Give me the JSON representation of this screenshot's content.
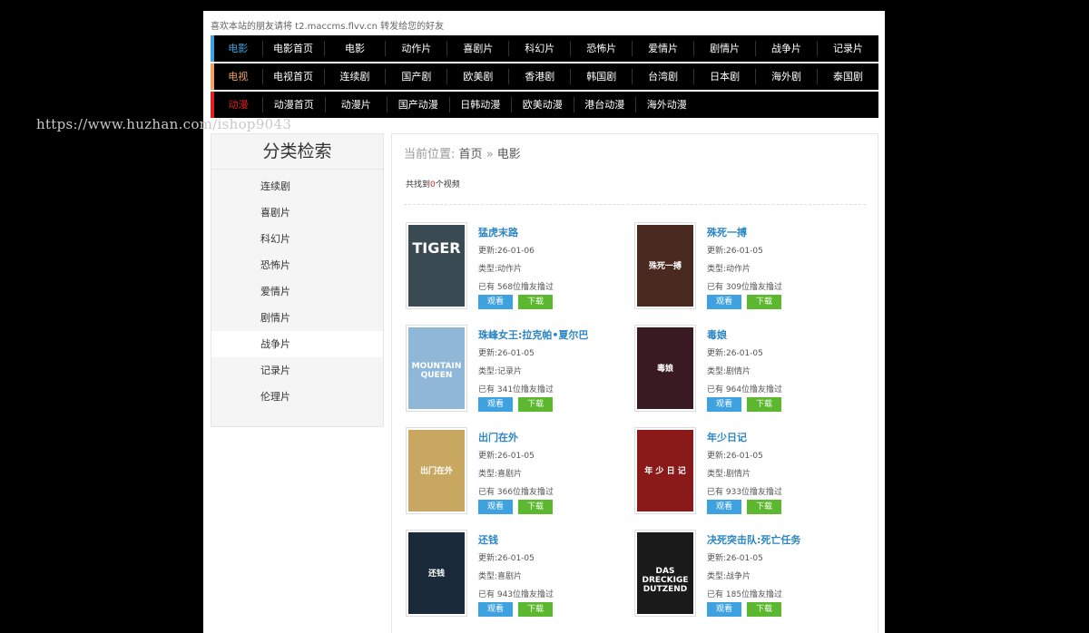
{
  "notice": "喜欢本站的朋友请将 t2.maccms.flvv.cn 转发给您的好友",
  "nav": [
    {
      "category": "电影",
      "items": [
        "电影首页",
        "电影",
        "动作片",
        "喜剧片",
        "科幻片",
        "恐怖片",
        "爱情片",
        "剧情片",
        "战争片",
        "记录片"
      ]
    },
    {
      "category": "电视",
      "items": [
        "电视首页",
        "连续剧",
        "国产剧",
        "欧美剧",
        "香港剧",
        "韩国剧",
        "台湾剧",
        "日本剧",
        "海外剧",
        "泰国剧"
      ]
    },
    {
      "category": "动漫",
      "items": [
        "动漫首页",
        "动漫片",
        "国产动漫",
        "日韩动漫",
        "欧美动漫",
        "港台动漫",
        "海外动漫"
      ]
    }
  ],
  "watermark": "https://www.huzhan.com/ishop9043",
  "sidebar": {
    "title": "分类检索",
    "items": [
      "连续剧",
      "喜剧片",
      "科幻片",
      "恐怖片",
      "爱情片",
      "剧情片",
      "战争片",
      "记录片",
      "伦理片"
    ]
  },
  "breadcrumb": {
    "prefix": "当前位置:",
    "home": "首页",
    "sep": "»",
    "current": "电影"
  },
  "result": {
    "before": "共找到",
    "num": "0",
    "after": "个视频"
  },
  "buttons": {
    "watch": "观看",
    "download": "下载"
  },
  "movies": [
    {
      "title": "猛虎末路",
      "updated": "更新:26-01-06",
      "genre": "类型:动作片",
      "viewers": "已有 568位撸友撸过",
      "poster_text": "TIGER",
      "poster_color": "#3a4a52"
    },
    {
      "title": "殊死一搏",
      "updated": "更新:26-01-05",
      "genre": "类型:动作片",
      "viewers": "已有 309位撸友撸过",
      "poster_text": "殊死一搏",
      "poster_color": "#4a2a20"
    },
    {
      "title": "珠峰女王:拉克帕•夏尔巴",
      "updated": "更新:26-01-05",
      "genre": "类型:记录片",
      "viewers": "已有 341位撸友撸过",
      "poster_text": "MOUNTAIN QUEEN",
      "poster_color": "#8fb8d8"
    },
    {
      "title": "毒娘",
      "updated": "更新:26-01-05",
      "genre": "类型:剧情片",
      "viewers": "已有 964位撸友撸过",
      "poster_text": "毒娘",
      "poster_color": "#3a1a22"
    },
    {
      "title": "出门在外",
      "updated": "更新:26-01-05",
      "genre": "类型:喜剧片",
      "viewers": "已有 366位撸友撸过",
      "poster_text": "出门在外",
      "poster_color": "#c8a860"
    },
    {
      "title": "年少日记",
      "updated": "更新:26-01-05",
      "genre": "类型:剧情片",
      "viewers": "已有 933位撸友撸过",
      "poster_text": "年 少 日 记",
      "poster_color": "#8a1a1a"
    },
    {
      "title": "还钱",
      "updated": "更新:26-01-05",
      "genre": "类型:喜剧片",
      "viewers": "已有 943位撸友撸过",
      "poster_text": "还钱",
      "poster_color": "#1a2a3a"
    },
    {
      "title": "决死突击队:死亡任务",
      "updated": "更新:26-01-05",
      "genre": "类型:战争片",
      "viewers": "已有 185位撸友撸过",
      "poster_text": "DAS DRECKIGE DUTZEND",
      "poster_color": "#1a1a1a"
    }
  ]
}
